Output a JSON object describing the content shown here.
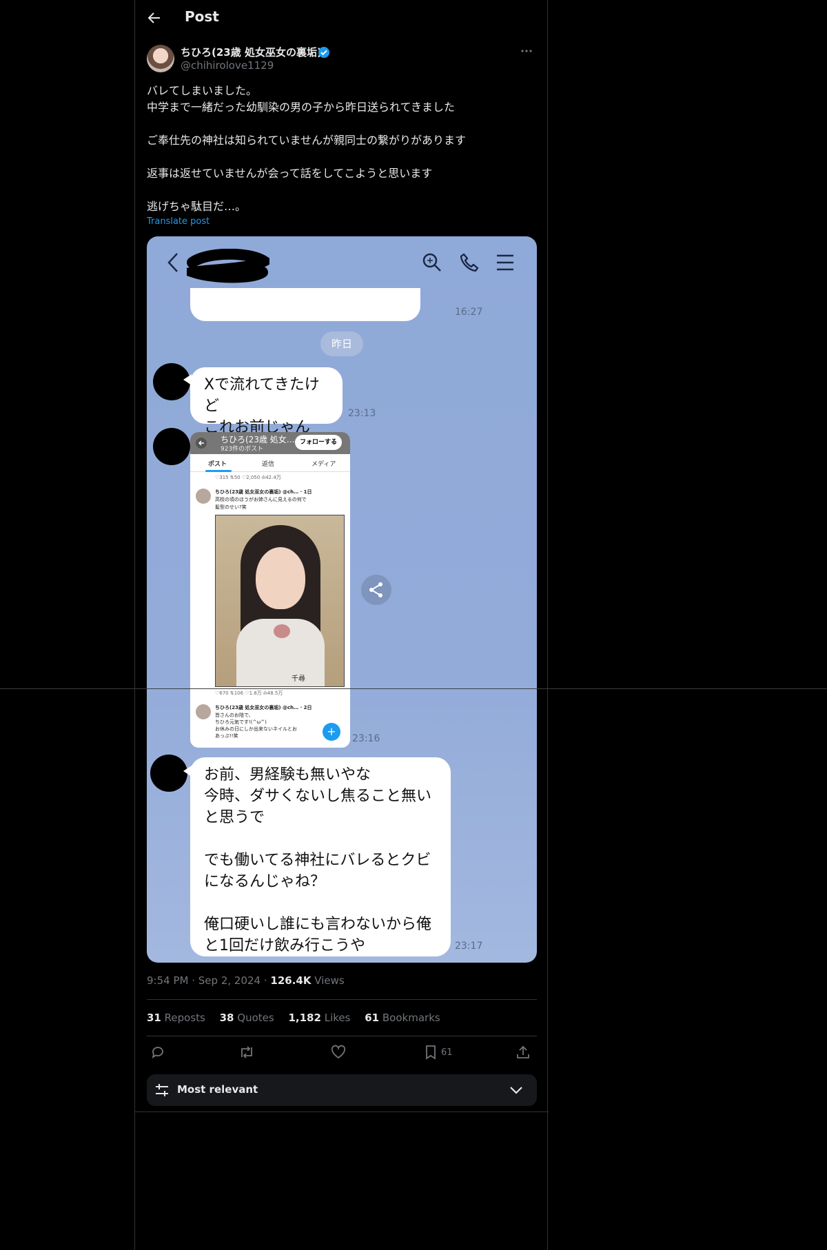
{
  "header": {
    "title": "Post"
  },
  "author": {
    "name": "ちひろ(23歳 処女巫女の裏垢)",
    "handle": "@chihirolove1129"
  },
  "post": {
    "text": "バレてしまいました。\n中学まで一緒だった幼馴染の男の子から昨日送られてきました\n\nご奉仕先の神社は知られていませんが親同士の繋がりがあります\n\n返事は返せていませんが会って話をしてこようと思います\n\n逃げちゃ駄目だ…。",
    "translate_label": "Translate post"
  },
  "chat": {
    "first_time": "16:27",
    "date_pill": "昨日",
    "messages": [
      {
        "text": "Xで流れてきたけど\nこれお前じゃん",
        "time": "23:13"
      },
      {
        "text": "",
        "time": "23:16"
      },
      {
        "text": "お前、男経験も無いやな\n今時、ダサくないし焦ること無い\nと思うで\n\nでも働いてる神社にバレるとクビ\nになるんじゃね？\n\n俺口硬いし誰にも言わないから俺\nと1回だけ飲み行こうや",
        "time": "23:17"
      }
    ],
    "screenshot": {
      "title": "ちひろ(23歳 処女…",
      "subtitle": "923件のポスト",
      "follow": "フォローする",
      "tabs": [
        "ポスト",
        "返信",
        "メディア"
      ],
      "row1": "♡315   ⇅50   ♡2,050   ılı42.4万",
      "post1_name": "ちひろ(23歳 処女巫女の裏垢) @ch… · 1日",
      "post1_text": "高校の頃のほうがお姉さんに見えるの何で",
      "post1_text2": "髪型のせい?笑",
      "photo_caption": "千尋",
      "row2": "♡670   ⇅106   ♡1.8万   ılı48.5万",
      "post2_name": "ちひろ(23歳 処女巫女の裏垢) @ch… · 2日",
      "post2_text": "皆さんのお陰で、",
      "post2_text2": "ちひろ元気です!(^ω^)",
      "post2_text3": "お休みの日にしか出来ないネイルとお",
      "post2_text4": "あっぷ!!笑"
    }
  },
  "meta": {
    "time": "9:54 PM",
    "date": "Sep 2, 2024",
    "views_count": "126.4K",
    "views_label": "Views"
  },
  "stats": {
    "reposts_count": "31",
    "reposts_label": "Reposts",
    "quotes_count": "38",
    "quotes_label": "Quotes",
    "likes_count": "1,182",
    "likes_label": "Likes",
    "bookmarks_count": "61",
    "bookmarks_label": "Bookmarks"
  },
  "actions": {
    "bookmark_count": "61"
  },
  "sort": {
    "label": "Most relevant"
  },
  "colors": {
    "accent": "#1d9bf0",
    "background": "#000000",
    "chat_bg": "#93abd9"
  }
}
